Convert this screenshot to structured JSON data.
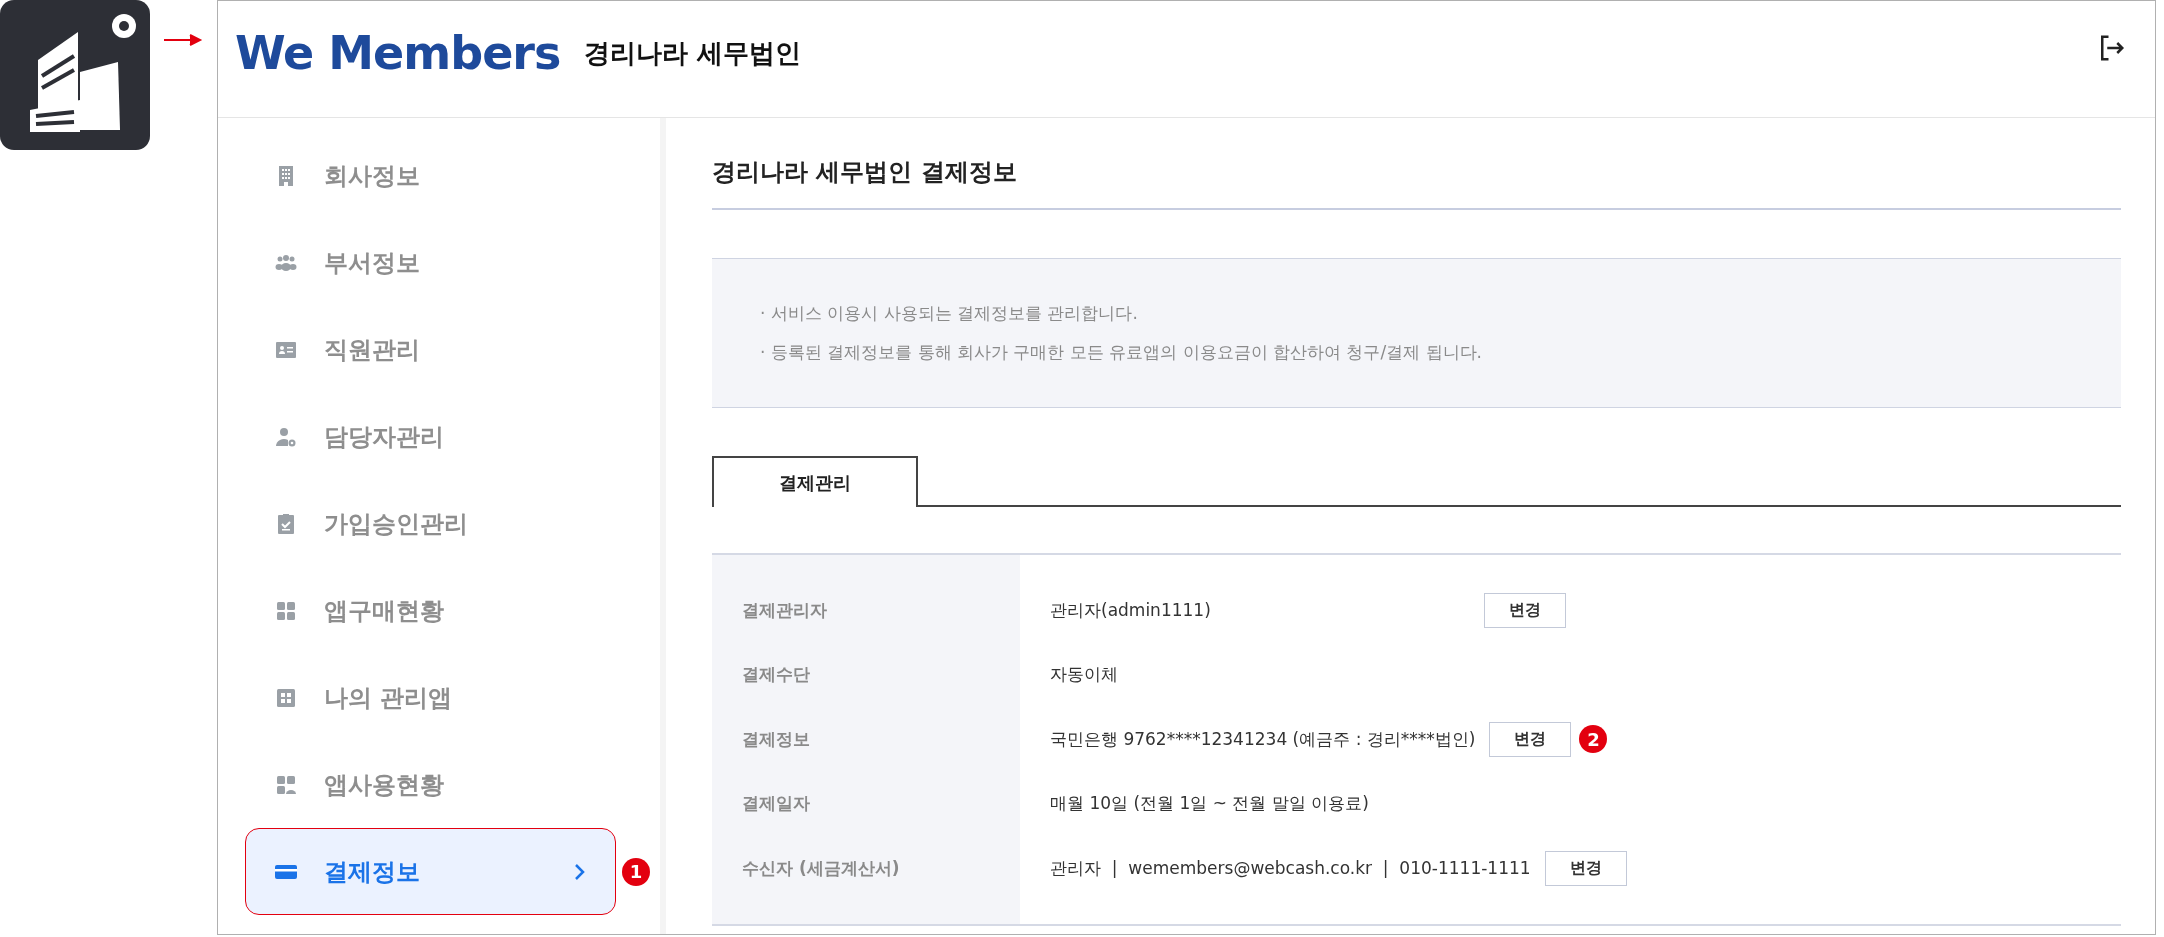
{
  "header": {
    "logo": "We Members",
    "company": "경리나라 세무법인"
  },
  "sidebar": {
    "items": [
      {
        "label": "회사정보",
        "selected": false
      },
      {
        "label": "부서정보",
        "selected": false
      },
      {
        "label": "직원관리",
        "selected": false
      },
      {
        "label": "담당자관리",
        "selected": false
      },
      {
        "label": "가입승인관리",
        "selected": false
      },
      {
        "label": "앱구매현황",
        "selected": false
      },
      {
        "label": "나의 관리앱",
        "selected": false
      },
      {
        "label": "앱사용현황",
        "selected": false
      },
      {
        "label": "결제정보",
        "selected": true,
        "marker": "1"
      }
    ]
  },
  "page_title": "경리나라 세무법인 결제정보",
  "notices": [
    "· 서비스 이용시 사용되는 결제정보를 관리합니다.",
    "· 등록된 결제정보를 통해 회사가 구매한 모든 유료앱의 이용요금이 합산하여 청구/결제 됩니다."
  ],
  "tabs": [
    {
      "label": "결제관리",
      "selected": true
    }
  ],
  "rows": [
    {
      "label": "결제관리자",
      "value": "관리자(admin1111)",
      "button": "변경"
    },
    {
      "label": "결제수단",
      "value": "자동이체"
    },
    {
      "label": "결제정보",
      "value": "국민은행 9762****12341234 (예금주 : 경리****법인)",
      "button": "변경",
      "marker": "2"
    },
    {
      "label": "결제일자",
      "value": "매월 10일 (전월 1일 ~ 전월 말일 이용료)"
    },
    {
      "label": "수신자 (세금계산서)",
      "value": "관리자  |  wemembers@webcash.co.kr  |  010-1111-1111",
      "button": "변경"
    }
  ]
}
